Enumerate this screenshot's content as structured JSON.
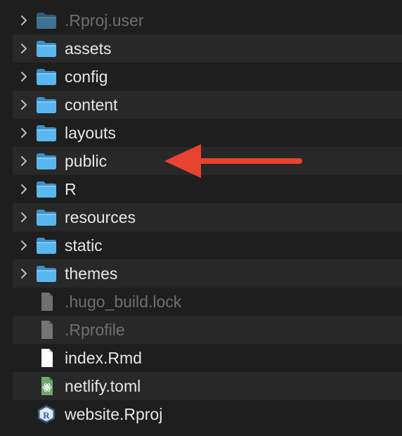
{
  "items": [
    {
      "name": ".Rproj.user",
      "kind": "folder",
      "icon": "folder-icon",
      "expandable": true,
      "hidden": true
    },
    {
      "name": "assets",
      "kind": "folder",
      "icon": "folder-icon",
      "expandable": true,
      "hidden": false
    },
    {
      "name": "config",
      "kind": "folder",
      "icon": "folder-icon",
      "expandable": true,
      "hidden": false
    },
    {
      "name": "content",
      "kind": "folder",
      "icon": "folder-icon",
      "expandable": true,
      "hidden": false
    },
    {
      "name": "layouts",
      "kind": "folder",
      "icon": "folder-icon",
      "expandable": true,
      "hidden": false
    },
    {
      "name": "public",
      "kind": "folder",
      "icon": "folder-icon",
      "expandable": true,
      "hidden": false
    },
    {
      "name": "R",
      "kind": "folder",
      "icon": "folder-icon",
      "expandable": true,
      "hidden": false
    },
    {
      "name": "resources",
      "kind": "folder",
      "icon": "folder-icon",
      "expandable": true,
      "hidden": false
    },
    {
      "name": "static",
      "kind": "folder",
      "icon": "folder-icon",
      "expandable": true,
      "hidden": false
    },
    {
      "name": "themes",
      "kind": "folder",
      "icon": "folder-icon",
      "expandable": true,
      "hidden": false
    },
    {
      "name": ".hugo_build.lock",
      "kind": "file",
      "icon": "generic-file-icon",
      "expandable": false,
      "hidden": true
    },
    {
      "name": ".Rprofile",
      "kind": "file",
      "icon": "generic-file-icon",
      "expandable": false,
      "hidden": true
    },
    {
      "name": "index.Rmd",
      "kind": "file",
      "icon": "document-file-icon",
      "expandable": false,
      "hidden": false
    },
    {
      "name": "netlify.toml",
      "kind": "file",
      "icon": "toml-file-icon",
      "expandable": false,
      "hidden": false
    },
    {
      "name": "website.Rproj",
      "kind": "file",
      "icon": "rproj-file-icon",
      "expandable": false,
      "hidden": false
    }
  ],
  "annotation": {
    "target": "public",
    "icon": "red-arrow-icon",
    "color": "#e8432f"
  },
  "colors": {
    "background": "#1e1e1e",
    "stripe": "#282828",
    "text": "#e6e6e6",
    "hidden_text": "#6f6f6f",
    "folder_blue": "#5ab7ee"
  }
}
